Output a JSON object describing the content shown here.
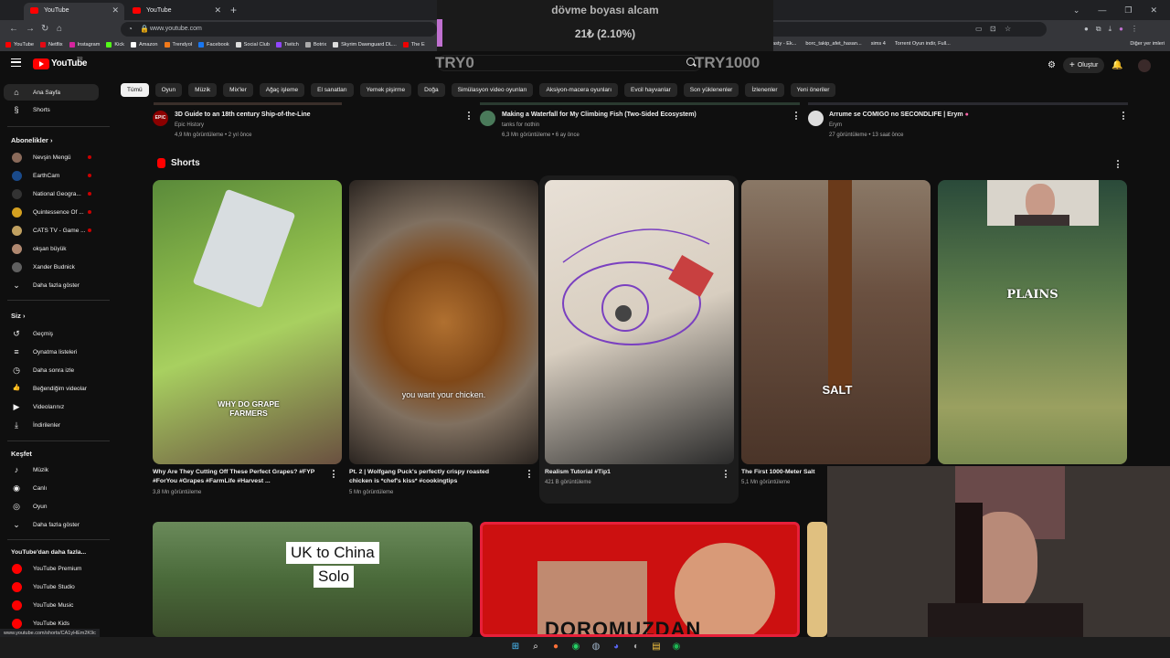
{
  "browser": {
    "tabs": [
      {
        "label": "YouTube",
        "active": true
      },
      {
        "label": "YouTube",
        "active": false
      }
    ],
    "new_tab_symbol": "+",
    "window_controls": [
      "⌄",
      "—",
      "❐",
      "✕"
    ],
    "url": "www.youtube.com",
    "bookmarks": [
      "YouTube",
      "Netflix",
      "Instagram",
      "Kick",
      "Amazon",
      "Trendyol",
      "Facebook",
      "Social Club",
      "Twitch",
      "Botrix",
      "Skyrim Dawnguard DL...",
      "The E"
    ],
    "bookmarks_right": [
      "asty - Ek...",
      "borc_takip_afet_hasan...",
      "sims 4",
      "Torrent Oyun indir, Full..."
    ],
    "other_bookmarks": "Diğer yer imleri",
    "status_url": "www.youtube.com/shorts/CA1yHEm2K9c"
  },
  "stream_overlay": {
    "title": "dövme boyası alcam",
    "amount": "21₺ (2.10%)",
    "goal_start": "TRY0",
    "goal_end": "TRY1000",
    "accent": "#c070d0"
  },
  "youtube": {
    "logo_text": "YouTube",
    "region": "TR",
    "create_label": "Oluştur",
    "chips": [
      "Tümü",
      "Oyun",
      "Müzik",
      "Mix'ler",
      "Ağaç işleme",
      "El sanatları",
      "Yemek pişirme",
      "Doğa",
      "Simülasyon video oyunları",
      "Aksiyon-macera oyunları",
      "Evcil hayvanlar",
      "Son yüklenenler",
      "İzlenenler",
      "Yeni öneriler"
    ],
    "sidebar": {
      "main": [
        {
          "label": "Ana Sayfa",
          "icon": "home-icon",
          "glyph": "⌂"
        },
        {
          "label": "Shorts",
          "icon": "shorts-icon",
          "glyph": "§"
        }
      ],
      "subscriptions_heading": "Abonelikler",
      "subscriptions": [
        {
          "label": "Nevşin Mengü",
          "color": "#8a6a5a",
          "live": true
        },
        {
          "label": "EarthCam",
          "color": "#1a4a8a",
          "live": true
        },
        {
          "label": "National Geogra...",
          "color": "#333333",
          "live": true
        },
        {
          "label": "Quintessence Of ...",
          "color": "#d4a020",
          "live": true
        },
        {
          "label": "CATS TV - Game ...",
          "color": "#c0a060",
          "live": true
        },
        {
          "label": "okşan büyük",
          "color": "#b08870",
          "live": false
        },
        {
          "label": "Xander Budnick",
          "color": "#606060",
          "live": false
        }
      ],
      "show_more": "Daha fazla göster",
      "you_heading": "Siz",
      "you_items": [
        {
          "label": "Geçmiş",
          "icon": "history-icon",
          "glyph": "↺"
        },
        {
          "label": "Oynatma listeleri",
          "icon": "playlist-icon",
          "glyph": "≡"
        },
        {
          "label": "Daha sonra izle",
          "icon": "clock-icon",
          "glyph": "◷"
        },
        {
          "label": "Beğendiğim videolar",
          "icon": "like-icon",
          "glyph": "👍"
        },
        {
          "label": "Videolarınız",
          "icon": "video-icon",
          "glyph": "▶"
        },
        {
          "label": "İndirilenler",
          "icon": "download-icon",
          "glyph": "⤓"
        }
      ],
      "explore_heading": "Keşfet",
      "explore_items": [
        {
          "label": "Müzik",
          "icon": "music-icon",
          "glyph": "♪"
        },
        {
          "label": "Canlı",
          "icon": "live-icon",
          "glyph": "◉"
        },
        {
          "label": "Oyun",
          "icon": "game-icon",
          "glyph": "◎"
        }
      ],
      "show_more_2": "Daha fazla göster",
      "more_heading": "YouTube'dan daha fazla...",
      "more_items": [
        "YouTube Premium",
        "YouTube Studio",
        "YouTube Music",
        "YouTube Kids"
      ]
    },
    "top_videos": [
      {
        "title": "3D Guide to an 18th century Ship-of-the-Line",
        "channel": "Epic History",
        "meta": "4,9 Mn görüntüleme • 2 yıl önce",
        "avatar": "EPIC"
      },
      {
        "title": "Making a Waterfall for My Climbing Fish (Two-Sided Ecosystem)",
        "channel": "tanks for nothin",
        "meta": "6,3 Mn görüntüleme • 6 ay önce",
        "avatar": ""
      },
      {
        "title": "Arrume se COMIGO no SECONDLIFE | Erym",
        "channel": "Erym",
        "meta": "27 görüntüleme • 13 saat önce",
        "avatar": ""
      }
    ],
    "shorts_heading": "Shorts",
    "shorts": [
      {
        "title": "Why Are They Cutting Off These Perfect Grapes? #FYP #ForYou #Grapes #FarmLife #Harvest ...",
        "meta": "3,8 Mn görüntüleme",
        "caption": "WHY DO GRAPE FARMERS"
      },
      {
        "title": "Pt. 2 | Wolfgang Puck's perfectly crispy roasted chicken is *chef's kiss* #cookingtips",
        "meta": "5 Mn görüntüleme",
        "caption": "you want your chicken."
      },
      {
        "title": "Realism Tutorial #Tip1",
        "meta": "421 B görüntüleme",
        "caption": ""
      },
      {
        "title": "The First 1000-Meter Salt",
        "meta": "5,1 Mn görüntüleme",
        "caption": "SALT"
      },
      {
        "title": "",
        "meta": "",
        "caption": "PLAINS"
      }
    ],
    "bottom_thumbs": [
      {
        "caption_line1": "UK to China",
        "caption_line2": "Solo"
      },
      {
        "caption_line1": "DOROMUZDAN",
        "caption_line2": ""
      }
    ]
  }
}
